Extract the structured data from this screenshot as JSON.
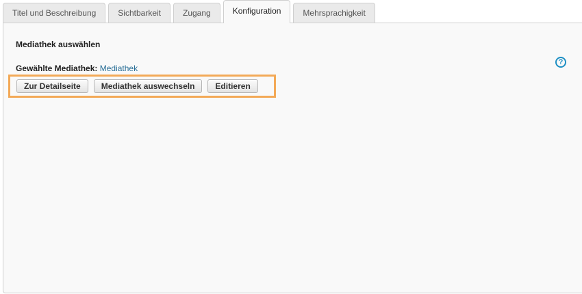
{
  "tabs": [
    {
      "label": "Titel und Beschreibung",
      "active": false
    },
    {
      "label": "Sichtbarkeit",
      "active": false
    },
    {
      "label": "Zugang",
      "active": false
    },
    {
      "label": "Konfiguration",
      "active": true
    },
    {
      "label": "Mehrsprachigkeit",
      "active": false
    }
  ],
  "panel": {
    "section_title": "Mediathek auswählen",
    "chosen_label": "Gewählte Mediathek:",
    "chosen_value": "Mediathek",
    "help_icon": "help-icon",
    "buttons": {
      "details": "Zur Detailseite",
      "switch": "Mediathek auswechseln",
      "edit": "Editieren"
    }
  },
  "colors": {
    "highlight_border": "#f3a957",
    "link": "#2a6f97",
    "help_icon": "#1d8fc4",
    "panel_background": "#f9f9f9"
  }
}
